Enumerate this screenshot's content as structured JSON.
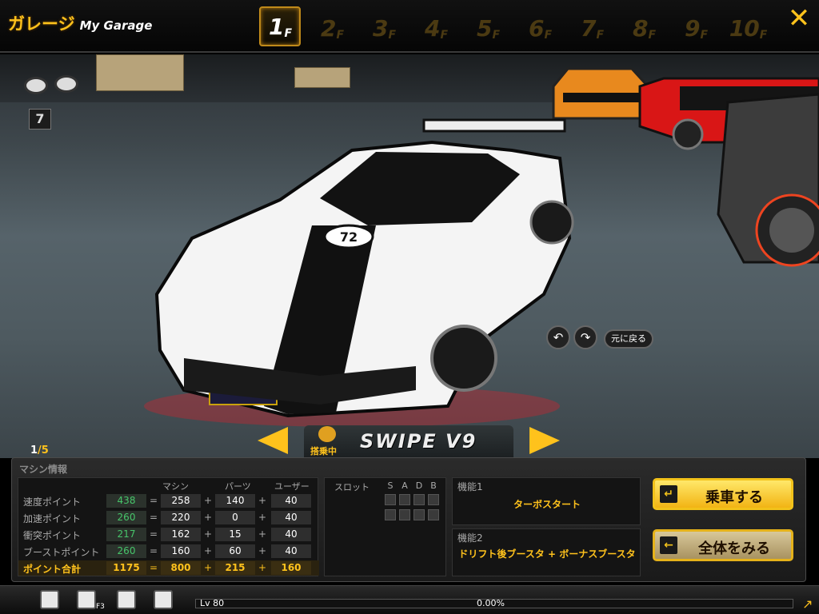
{
  "header": {
    "title_jp": "ガレージ",
    "title_en": "My Garage",
    "floors": [
      {
        "num": "1",
        "suffix": "F",
        "active": true
      },
      {
        "num": "2",
        "suffix": "F",
        "active": false
      },
      {
        "num": "3",
        "suffix": "F",
        "active": false
      },
      {
        "num": "4",
        "suffix": "F",
        "active": false
      },
      {
        "num": "5",
        "suffix": "F",
        "active": false
      },
      {
        "num": "6",
        "suffix": "F",
        "active": false
      },
      {
        "num": "7",
        "suffix": "F",
        "active": false
      },
      {
        "num": "8",
        "suffix": "F",
        "active": false
      },
      {
        "num": "9",
        "suffix": "F",
        "active": false
      },
      {
        "num": "10",
        "suffix": "F",
        "active": false
      }
    ],
    "close_icon": "close-x-icon"
  },
  "scene": {
    "parking_slot_number": "7",
    "car_number_decal": "72",
    "rotate_left_icon": "rotate-left-icon",
    "rotate_right_icon": "rotate-right-icon",
    "reset_label": "元に戻る"
  },
  "car_select": {
    "current": "1",
    "total": "5",
    "car_name": "SWIPE V9",
    "riding_label": "搭乗中"
  },
  "info": {
    "panel_title": "マシン情報",
    "columns": [
      "マシン",
      "パーツ",
      "ユーザー"
    ],
    "stats": [
      {
        "label": "速度ポイント",
        "total": "438",
        "machine": "258",
        "parts": "140",
        "user": "40"
      },
      {
        "label": "加速ポイント",
        "total": "260",
        "machine": "220",
        "parts": "0",
        "user": "40"
      },
      {
        "label": "衝突ポイント",
        "total": "217",
        "machine": "162",
        "parts": "15",
        "user": "40"
      },
      {
        "label": "ブーストポイント",
        "total": "260",
        "machine": "160",
        "parts": "60",
        "user": "40"
      }
    ],
    "sum": {
      "label": "ポイント合計",
      "total": "1175",
      "machine": "800",
      "parts": "215",
      "user": "160"
    },
    "ops": {
      "eq": "=",
      "plus": "+"
    },
    "slots": {
      "label": "スロット",
      "letters": [
        "S",
        "A",
        "D",
        "B"
      ]
    },
    "ability1": {
      "label": "機能1",
      "value": "ターボスタート"
    },
    "ability2": {
      "label": "機能2",
      "value": "ドリフト後ブースタ + ボーナスブースタ"
    }
  },
  "actions": {
    "ride_label": "乗車する",
    "ride_icon": "enter-arrow-icon",
    "view_all_label": "全体をみる",
    "view_all_icon": "back-arrow-icon"
  },
  "bottom": {
    "hotkey": "F3",
    "level": "Lv 80",
    "exp_percent": "0.00%",
    "exp_fraction": 0.0
  },
  "colors": {
    "accent": "#ffc21c",
    "stat_total": "#47c56a"
  }
}
